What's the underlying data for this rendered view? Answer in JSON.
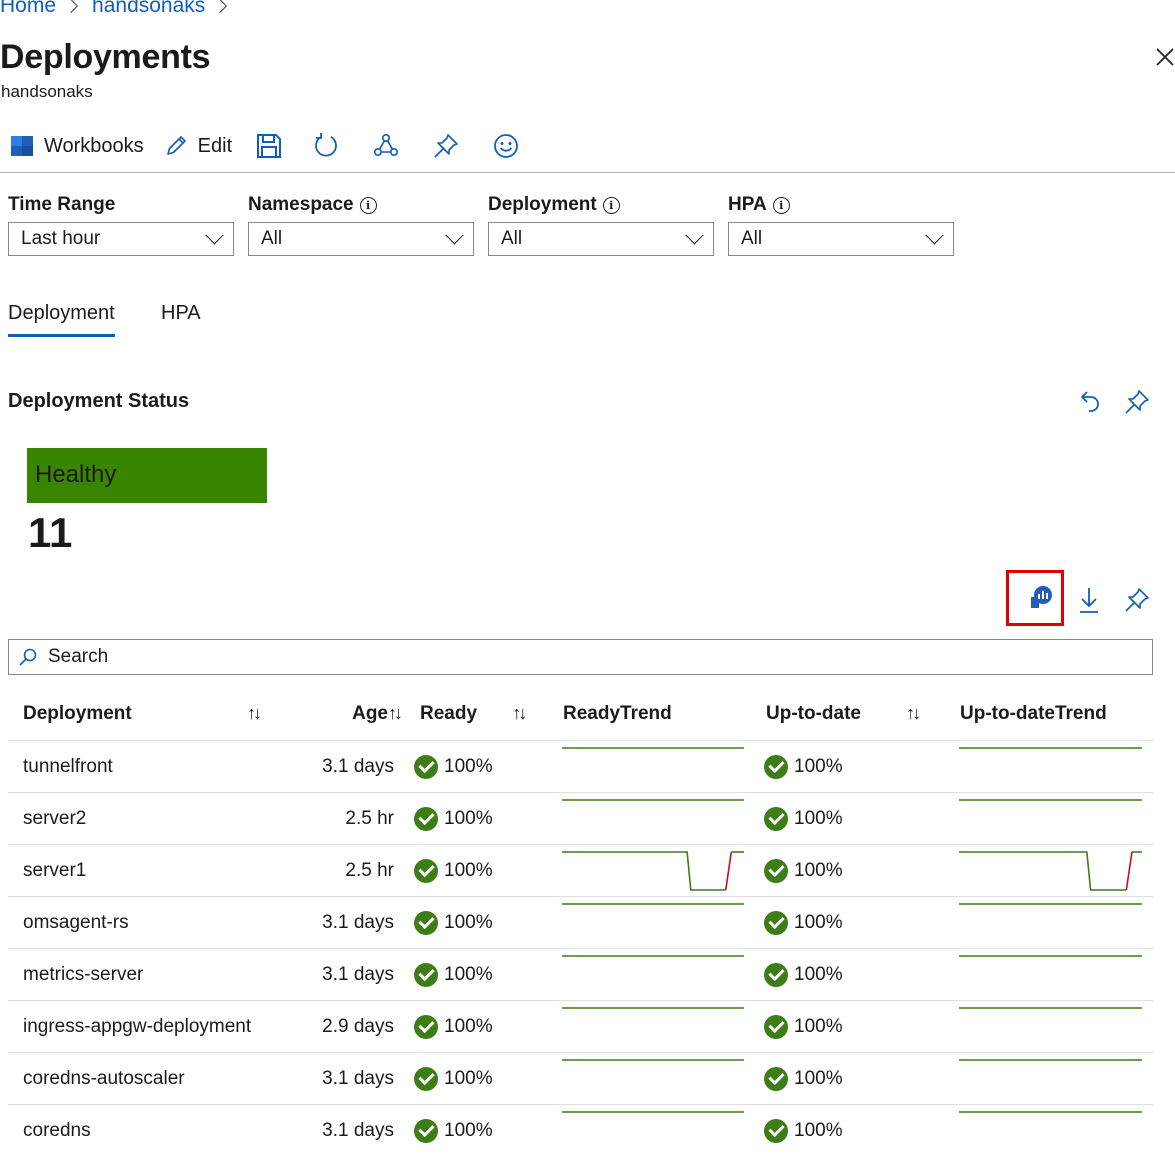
{
  "breadcrumb": {
    "home": "Home",
    "resource": "handsonaks"
  },
  "header": {
    "title": "Deployments",
    "subtitle": "handsonaks"
  },
  "toolbar": {
    "workbooks_label": "Workbooks",
    "edit_label": "Edit",
    "icons": [
      "workbooks-icon",
      "edit-icon",
      "save-icon",
      "refresh-icon",
      "share-icon",
      "pin-icon",
      "feedback-icon"
    ]
  },
  "filters": [
    {
      "label": "Time Range",
      "value": "Last hour",
      "info": false
    },
    {
      "label": "Namespace",
      "value": "All",
      "info": true
    },
    {
      "label": "Deployment",
      "value": "All",
      "info": true
    },
    {
      "label": "HPA",
      "value": "All",
      "info": true
    }
  ],
  "info_glyph": "i",
  "tabs": [
    {
      "label": "Deployment",
      "active": true
    },
    {
      "label": "HPA",
      "active": false
    }
  ],
  "status_section": {
    "title": "Deployment Status",
    "tile_label": "Healthy",
    "tile_value": "11",
    "tile_color": "#3a8500"
  },
  "search": {
    "placeholder": "Search"
  },
  "table": {
    "headers": {
      "deployment": "Deployment",
      "age": "Age",
      "ready": "Ready",
      "ready_trend": "ReadyTrend",
      "uptodate": "Up-to-date",
      "uptodate_trend": "Up-to-dateTrend"
    },
    "sort_glyph": "↑↓",
    "rows": [
      {
        "deployment": "tunnelfront",
        "age": "3.1 days",
        "ready": "100%",
        "uptodate": "100%",
        "trend": "flat"
      },
      {
        "deployment": "server2",
        "age": "2.5 hr",
        "ready": "100%",
        "uptodate": "100%",
        "trend": "flat"
      },
      {
        "deployment": "server1",
        "age": "2.5 hr",
        "ready": "100%",
        "uptodate": "100%",
        "trend": "dip"
      },
      {
        "deployment": "omsagent-rs",
        "age": "3.1 days",
        "ready": "100%",
        "uptodate": "100%",
        "trend": "flat"
      },
      {
        "deployment": "metrics-server",
        "age": "3.1 days",
        "ready": "100%",
        "uptodate": "100%",
        "trend": "flat"
      },
      {
        "deployment": "ingress-appgw-deployment",
        "age": "2.9 days",
        "ready": "100%",
        "uptodate": "100%",
        "trend": "flat"
      },
      {
        "deployment": "coredns-autoscaler",
        "age": "3.1 days",
        "ready": "100%",
        "uptodate": "100%",
        "trend": "flat"
      },
      {
        "deployment": "coredns",
        "age": "3.1 days",
        "ready": "100%",
        "uptodate": "100%",
        "trend": "flat"
      }
    ]
  },
  "colors": {
    "accent": "#0f5dbd",
    "healthy": "#3a8500",
    "check": "#3d7d17",
    "trend_ok": "#3d7d17",
    "trend_bad": "#c50f1f",
    "highlight_box": "#e00000"
  }
}
